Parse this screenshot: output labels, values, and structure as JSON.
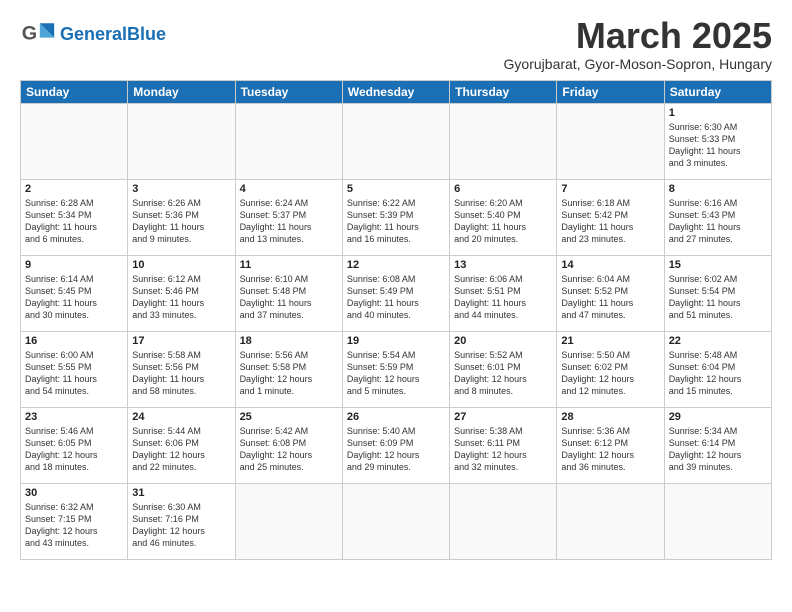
{
  "header": {
    "logo_general": "General",
    "logo_blue": "Blue",
    "month_year": "March 2025",
    "location": "Gyorujbarat, Gyor-Moson-Sopron, Hungary"
  },
  "weekdays": [
    "Sunday",
    "Monday",
    "Tuesday",
    "Wednesday",
    "Thursday",
    "Friday",
    "Saturday"
  ],
  "weeks": [
    [
      {
        "day": "",
        "info": ""
      },
      {
        "day": "",
        "info": ""
      },
      {
        "day": "",
        "info": ""
      },
      {
        "day": "",
        "info": ""
      },
      {
        "day": "",
        "info": ""
      },
      {
        "day": "",
        "info": ""
      },
      {
        "day": "1",
        "info": "Sunrise: 6:30 AM\nSunset: 5:33 PM\nDaylight: 11 hours\nand 3 minutes."
      }
    ],
    [
      {
        "day": "2",
        "info": "Sunrise: 6:28 AM\nSunset: 5:34 PM\nDaylight: 11 hours\nand 6 minutes."
      },
      {
        "day": "3",
        "info": "Sunrise: 6:26 AM\nSunset: 5:36 PM\nDaylight: 11 hours\nand 9 minutes."
      },
      {
        "day": "4",
        "info": "Sunrise: 6:24 AM\nSunset: 5:37 PM\nDaylight: 11 hours\nand 13 minutes."
      },
      {
        "day": "5",
        "info": "Sunrise: 6:22 AM\nSunset: 5:39 PM\nDaylight: 11 hours\nand 16 minutes."
      },
      {
        "day": "6",
        "info": "Sunrise: 6:20 AM\nSunset: 5:40 PM\nDaylight: 11 hours\nand 20 minutes."
      },
      {
        "day": "7",
        "info": "Sunrise: 6:18 AM\nSunset: 5:42 PM\nDaylight: 11 hours\nand 23 minutes."
      },
      {
        "day": "8",
        "info": "Sunrise: 6:16 AM\nSunset: 5:43 PM\nDaylight: 11 hours\nand 27 minutes."
      }
    ],
    [
      {
        "day": "9",
        "info": "Sunrise: 6:14 AM\nSunset: 5:45 PM\nDaylight: 11 hours\nand 30 minutes."
      },
      {
        "day": "10",
        "info": "Sunrise: 6:12 AM\nSunset: 5:46 PM\nDaylight: 11 hours\nand 33 minutes."
      },
      {
        "day": "11",
        "info": "Sunrise: 6:10 AM\nSunset: 5:48 PM\nDaylight: 11 hours\nand 37 minutes."
      },
      {
        "day": "12",
        "info": "Sunrise: 6:08 AM\nSunset: 5:49 PM\nDaylight: 11 hours\nand 40 minutes."
      },
      {
        "day": "13",
        "info": "Sunrise: 6:06 AM\nSunset: 5:51 PM\nDaylight: 11 hours\nand 44 minutes."
      },
      {
        "day": "14",
        "info": "Sunrise: 6:04 AM\nSunset: 5:52 PM\nDaylight: 11 hours\nand 47 minutes."
      },
      {
        "day": "15",
        "info": "Sunrise: 6:02 AM\nSunset: 5:54 PM\nDaylight: 11 hours\nand 51 minutes."
      }
    ],
    [
      {
        "day": "16",
        "info": "Sunrise: 6:00 AM\nSunset: 5:55 PM\nDaylight: 11 hours\nand 54 minutes."
      },
      {
        "day": "17",
        "info": "Sunrise: 5:58 AM\nSunset: 5:56 PM\nDaylight: 11 hours\nand 58 minutes."
      },
      {
        "day": "18",
        "info": "Sunrise: 5:56 AM\nSunset: 5:58 PM\nDaylight: 12 hours\nand 1 minute."
      },
      {
        "day": "19",
        "info": "Sunrise: 5:54 AM\nSunset: 5:59 PM\nDaylight: 12 hours\nand 5 minutes."
      },
      {
        "day": "20",
        "info": "Sunrise: 5:52 AM\nSunset: 6:01 PM\nDaylight: 12 hours\nand 8 minutes."
      },
      {
        "day": "21",
        "info": "Sunrise: 5:50 AM\nSunset: 6:02 PM\nDaylight: 12 hours\nand 12 minutes."
      },
      {
        "day": "22",
        "info": "Sunrise: 5:48 AM\nSunset: 6:04 PM\nDaylight: 12 hours\nand 15 minutes."
      }
    ],
    [
      {
        "day": "23",
        "info": "Sunrise: 5:46 AM\nSunset: 6:05 PM\nDaylight: 12 hours\nand 18 minutes."
      },
      {
        "day": "24",
        "info": "Sunrise: 5:44 AM\nSunset: 6:06 PM\nDaylight: 12 hours\nand 22 minutes."
      },
      {
        "day": "25",
        "info": "Sunrise: 5:42 AM\nSunset: 6:08 PM\nDaylight: 12 hours\nand 25 minutes."
      },
      {
        "day": "26",
        "info": "Sunrise: 5:40 AM\nSunset: 6:09 PM\nDaylight: 12 hours\nand 29 minutes."
      },
      {
        "day": "27",
        "info": "Sunrise: 5:38 AM\nSunset: 6:11 PM\nDaylight: 12 hours\nand 32 minutes."
      },
      {
        "day": "28",
        "info": "Sunrise: 5:36 AM\nSunset: 6:12 PM\nDaylight: 12 hours\nand 36 minutes."
      },
      {
        "day": "29",
        "info": "Sunrise: 5:34 AM\nSunset: 6:14 PM\nDaylight: 12 hours\nand 39 minutes."
      }
    ],
    [
      {
        "day": "30",
        "info": "Sunrise: 6:32 AM\nSunset: 7:15 PM\nDaylight: 12 hours\nand 43 minutes."
      },
      {
        "day": "31",
        "info": "Sunrise: 6:30 AM\nSunset: 7:16 PM\nDaylight: 12 hours\nand 46 minutes."
      },
      {
        "day": "",
        "info": ""
      },
      {
        "day": "",
        "info": ""
      },
      {
        "day": "",
        "info": ""
      },
      {
        "day": "",
        "info": ""
      },
      {
        "day": "",
        "info": ""
      }
    ]
  ]
}
